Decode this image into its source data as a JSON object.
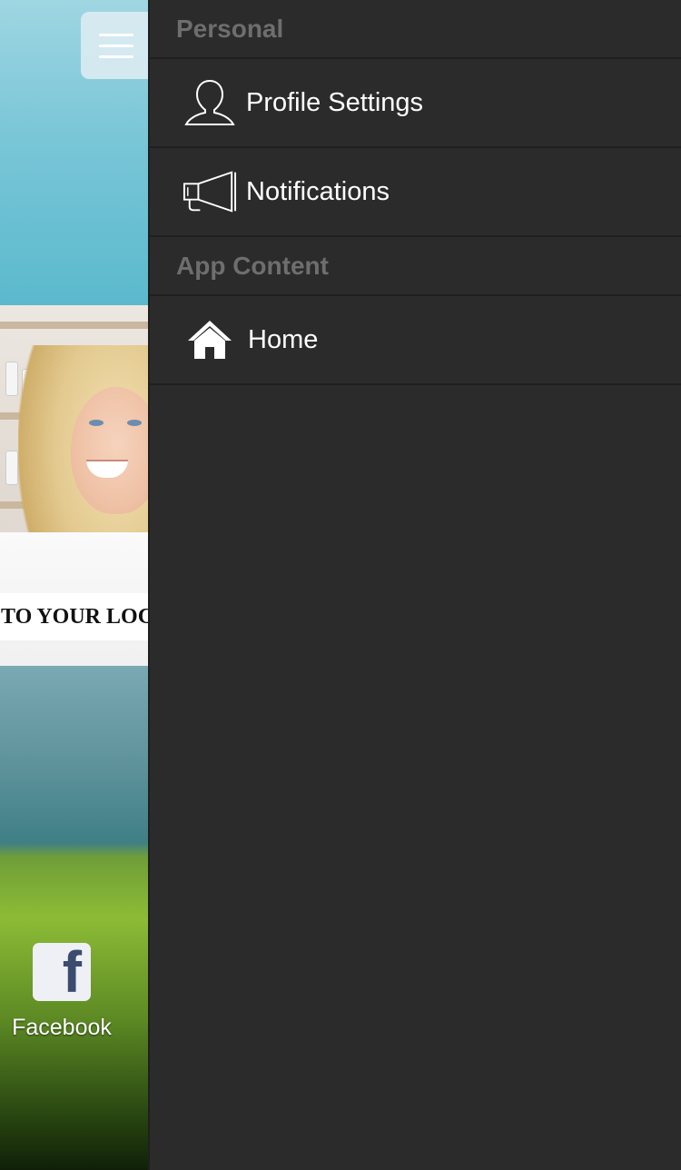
{
  "background_app": {
    "menu_button_icon": "hamburger-icon",
    "banner_text": "TO YOUR LOC",
    "facebook": {
      "icon": "facebook-icon",
      "icon_glyph": "f",
      "label": "Facebook"
    }
  },
  "drawer": {
    "sections": [
      {
        "header": "Personal",
        "items": [
          {
            "label": "Profile Settings",
            "icon": "user-outline-icon"
          },
          {
            "label": "Notifications",
            "icon": "megaphone-icon"
          }
        ]
      },
      {
        "header": "App Content",
        "items": [
          {
            "label": "Home",
            "icon": "home-icon"
          }
        ]
      }
    ]
  },
  "colors": {
    "drawer_background": "#2b2b2b",
    "section_header_text": "#6e6e6e",
    "item_text": "#ffffff",
    "divider": "#1f1f1f"
  }
}
